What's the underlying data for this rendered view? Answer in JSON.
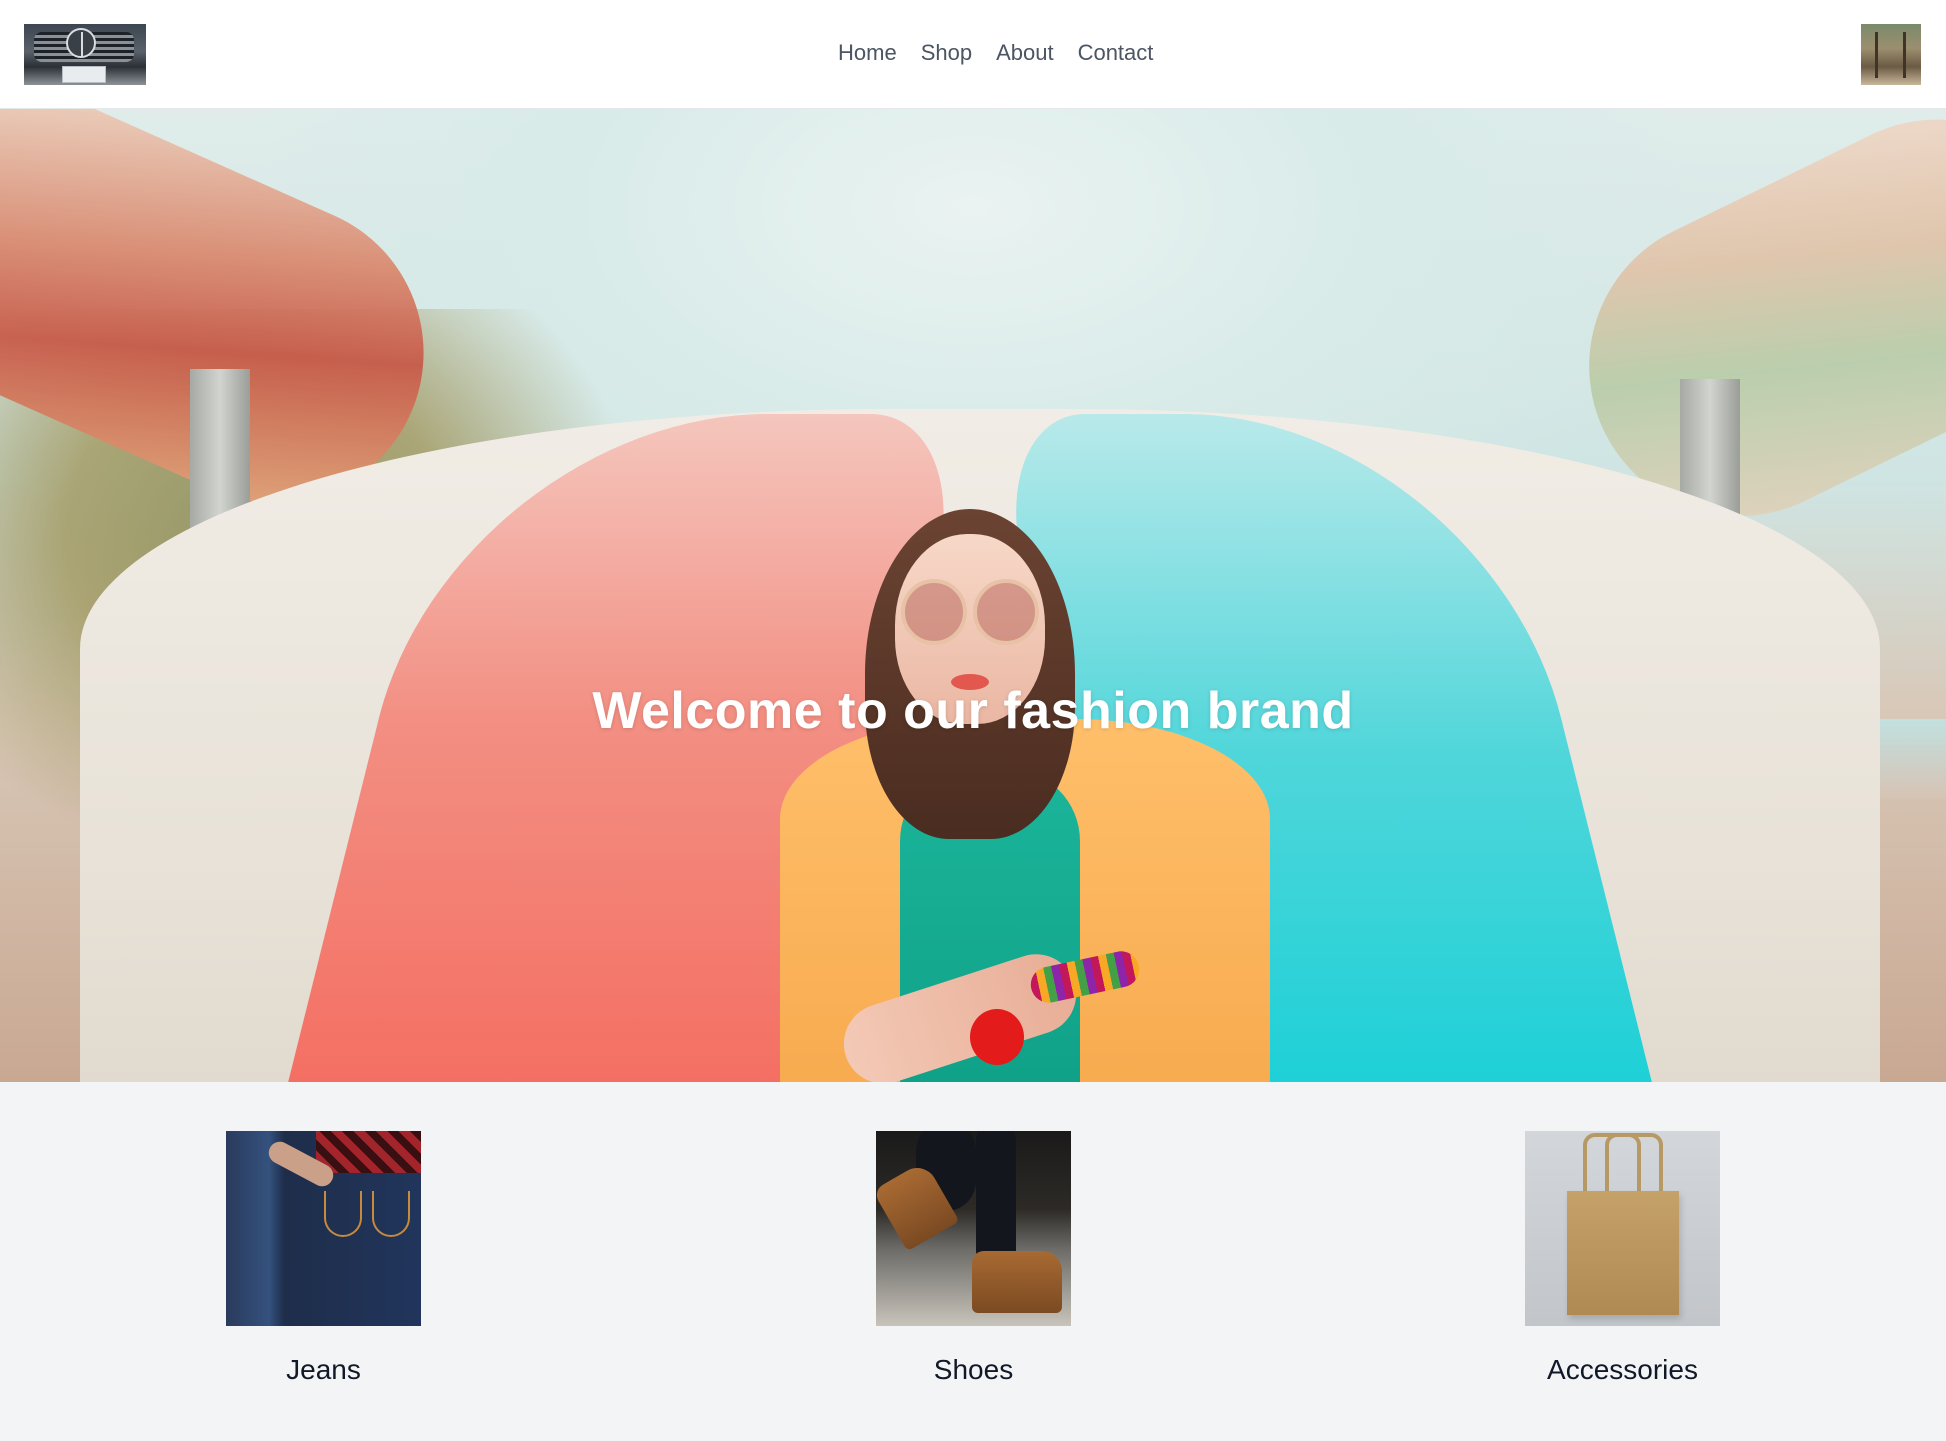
{
  "header": {
    "logo_icon": "car-logo-icon",
    "nav": [
      {
        "label": "Home"
      },
      {
        "label": "Shop"
      },
      {
        "label": "About"
      },
      {
        "label": "Contact"
      }
    ],
    "avatar_icon": "user-avatar-icon"
  },
  "hero": {
    "title": "Welcome to our fashion brand"
  },
  "categories": [
    {
      "label": "Jeans",
      "icon": "jeans-image"
    },
    {
      "label": "Shoes",
      "icon": "shoes-image"
    },
    {
      "label": "Accessories",
      "icon": "bag-image"
    }
  ],
  "colors": {
    "header_bg": "#ffffff",
    "nav_text": "#4b5563",
    "page_bg": "#f3f4f6",
    "hero_text": "#ffffff"
  }
}
